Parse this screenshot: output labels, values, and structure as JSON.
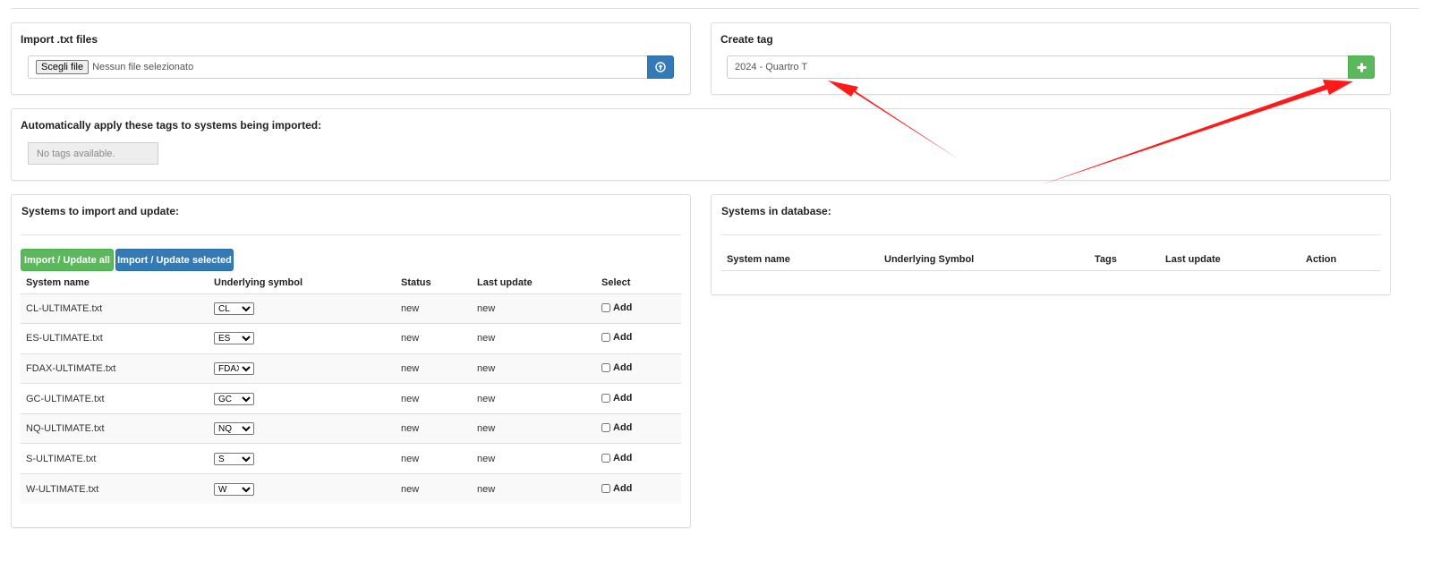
{
  "import_panel": {
    "title": "Import .txt files",
    "file_button": "Scegli file",
    "file_status": "Nessun file selezionato"
  },
  "tag_panel": {
    "title": "Create tag",
    "tag_value": "2024 - Quartro T",
    "add_icon": "plus-icon"
  },
  "auto_tags_panel": {
    "title": "Automatically apply these tags to systems being imported:",
    "empty_text": "No tags available."
  },
  "systems_import": {
    "title": "Systems to import and update:",
    "btn_update_all": "Import / Update all",
    "btn_update_selected": "Import / Update selected",
    "columns": [
      "System name",
      "Underlying symbol",
      "Status",
      "Last update",
      "Select"
    ],
    "rows": [
      {
        "name": "CL-ULTIMATE.txt",
        "symbol": "CL",
        "status": "new",
        "last_update": "new",
        "select_label": "Add"
      },
      {
        "name": "ES-ULTIMATE.txt",
        "symbol": "ES",
        "status": "new",
        "last_update": "new",
        "select_label": "Add"
      },
      {
        "name": "FDAX-ULTIMATE.txt",
        "symbol": "FDAX",
        "status": "new",
        "last_update": "new",
        "select_label": "Add"
      },
      {
        "name": "GC-ULTIMATE.txt",
        "symbol": "GC",
        "status": "new",
        "last_update": "new",
        "select_label": "Add"
      },
      {
        "name": "NQ-ULTIMATE.txt",
        "symbol": "NQ",
        "status": "new",
        "last_update": "new",
        "select_label": "Add"
      },
      {
        "name": "S-ULTIMATE.txt",
        "symbol": "S",
        "status": "new",
        "last_update": "new",
        "select_label": "Add"
      },
      {
        "name": "W-ULTIMATE.txt",
        "symbol": "W",
        "status": "new",
        "last_update": "new",
        "select_label": "Add"
      }
    ]
  },
  "systems_db": {
    "title": "Systems in database:",
    "columns": [
      "System name",
      "Underlying Symbol",
      "Tags",
      "Last update",
      "Action"
    ]
  },
  "colors": {
    "primary_blue": "#337ab7",
    "success_green": "#5cb85c",
    "annotation_red": "#ff1a1a"
  }
}
